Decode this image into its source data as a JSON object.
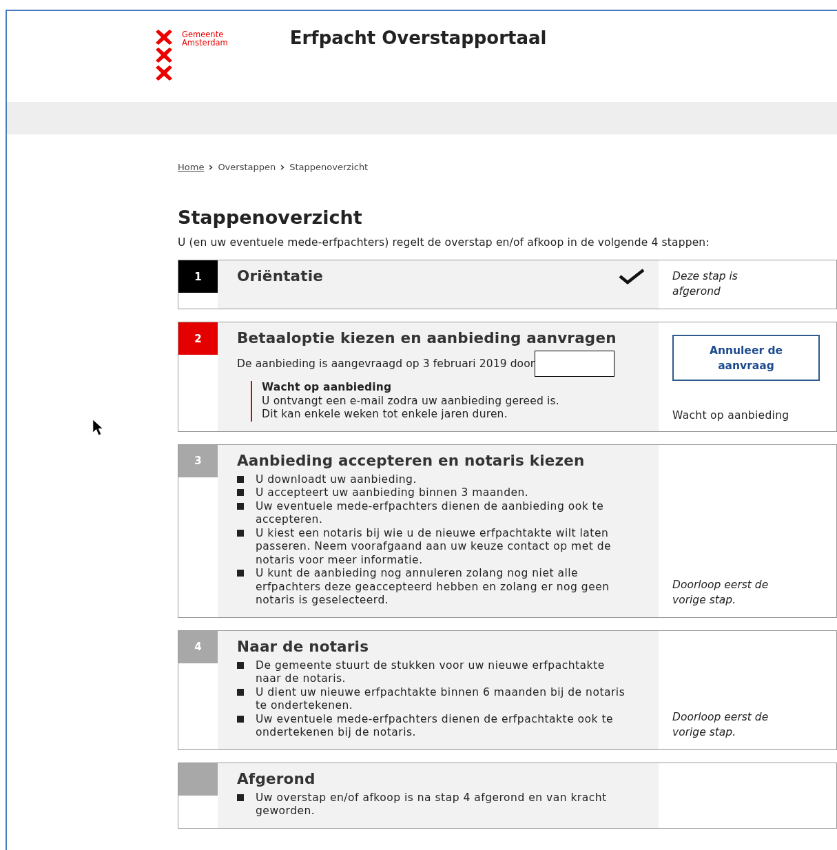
{
  "header": {
    "org_line1": "Gemeente",
    "org_line2": "Amsterdam",
    "title": "Erfpacht Overstapportaal"
  },
  "breadcrumb": [
    {
      "label": "Home",
      "link": true
    },
    {
      "label": "Overstappen",
      "link": false
    },
    {
      "label": "Stappenoverzicht",
      "link": false
    }
  ],
  "page_title": "Stappenoverzicht",
  "intro": "U (en uw eventuele mede-erfpachters) regelt de overstap en/of afkoop in de volgende 4 stappen:",
  "steps": [
    {
      "number": "1",
      "completed": true,
      "current": false,
      "title": "Oriëntatie",
      "side": {
        "kind": "note",
        "text": "Deze stap is afgerond"
      }
    },
    {
      "number": "2",
      "completed": false,
      "current": true,
      "title": "Betaaloptie kiezen en aanbieding aanvragen",
      "text": "De aanbieding is aangevraagd op 3 februari 2019 door",
      "notice": {
        "title": "Wacht op aanbieding",
        "lines": [
          "U ontvangt een e-mail zodra uw aanbieding gereed is.",
          "Dit kan enkele weken tot enkele jaren duren."
        ]
      },
      "side": {
        "kind": "action",
        "button": "Annuleer de aanvraag",
        "status": "Wacht op aanbieding"
      }
    },
    {
      "number": "3",
      "completed": false,
      "current": false,
      "title": "Aanbieding accepteren en notaris kiezen",
      "bullets": [
        "U downloadt uw aanbieding.",
        "U accepteert uw aanbieding binnen 3 maanden.",
        "Uw eventuele mede-erfpachters dienen de aanbieding ook te accepteren.",
        "U kiest een notaris bij wie u de nieuwe erfpachtakte wilt laten passeren. Neem voorafgaand aan uw keuze contact op met de notaris voor meer informatie.",
        "U kunt de aanbieding nog annuleren zolang nog niet alle erfpachters deze geaccepteerd hebben en zolang er nog geen notaris is geselecteerd."
      ],
      "side": {
        "kind": "note",
        "text": "Doorloop eerst de vorige stap."
      }
    },
    {
      "number": "4",
      "completed": false,
      "current": false,
      "title": "Naar de notaris",
      "bullets": [
        "De gemeente stuurt de stukken voor uw nieuwe erfpachtakte naar de notaris.",
        "U dient uw nieuwe erfpachtakte binnen 6 maanden bij de notaris te ondertekenen.",
        "Uw eventuele mede-erfpachters dienen de erfpachtakte ook te ondertekenen bij de notaris."
      ],
      "side": {
        "kind": "note",
        "text": "Doorloop eerst de vorige stap."
      }
    },
    {
      "completed": false,
      "current": false,
      "title": "Afgerond",
      "bullets": [
        "Uw overstap en/of afkoop is na stap 4 afgerond en van kracht geworden."
      ]
    }
  ]
}
